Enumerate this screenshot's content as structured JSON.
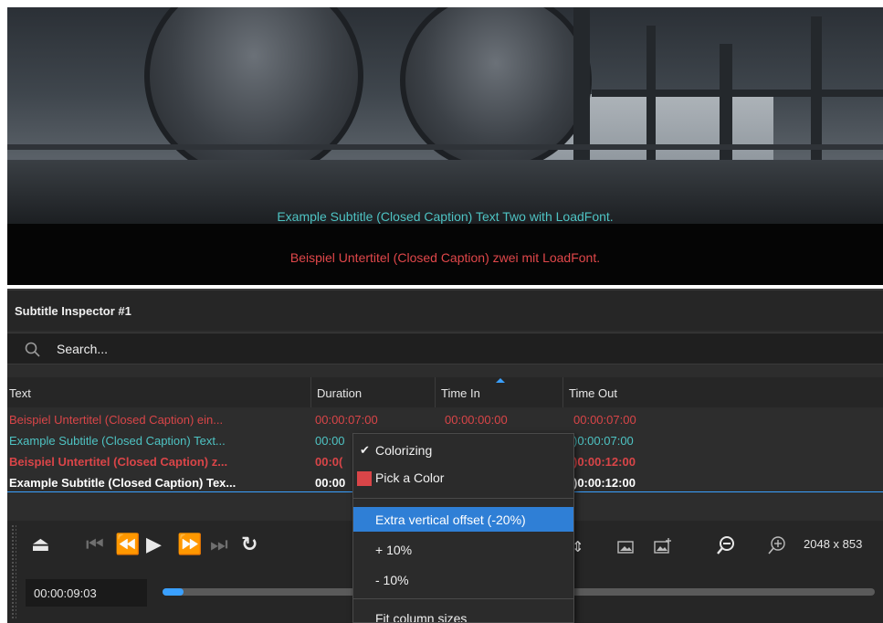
{
  "video": {
    "subtitle_line_1": "Example Subtitle (Closed Caption) Text Two with LoadFont.",
    "subtitle_line_2": "Beispiel Untertitel (Closed Caption) zwei mit LoadFont."
  },
  "inspector": {
    "title": "Subtitle Inspector #1",
    "search_placeholder": "Search...",
    "columns": [
      "Text",
      "Duration",
      "Time In",
      "Time Out"
    ],
    "rows": [
      {
        "text": "Beispiel Untertitel (Closed Caption) ein...",
        "duration": "00:00:07:00",
        "time_in": "00:00:00:00",
        "time_out": "00:00:07:00",
        "style": "red"
      },
      {
        "text": "Example Subtitle (Closed Caption) Text...",
        "duration": "00:00",
        "time_in": "",
        "time_out": ")0:00:07:00",
        "style": "cyan"
      },
      {
        "text": "Beispiel Untertitel (Closed Caption) z...",
        "duration": "00:0(",
        "time_in": "",
        "time_out": ")0:00:12:00",
        "style": "red-bold"
      },
      {
        "text": "Example Subtitle (Closed Caption) Tex...",
        "duration": "00:00",
        "time_in": "",
        "time_out": ")0:00:12:00",
        "style": "white-bold"
      }
    ]
  },
  "transport": {
    "timecode": "00:00:09:03",
    "resolution": "2048 x 853",
    "progress": 0.03
  },
  "context_menu": {
    "items": [
      {
        "label": "Colorizing",
        "checked": true
      },
      {
        "label": "Pick a Color",
        "swatch": "#d94548"
      },
      {
        "label": "Extra vertical offset (-20%)",
        "highlighted": true
      },
      {
        "label": "+ 10%"
      },
      {
        "label": "- 10%"
      },
      {
        "label": "Fit column sizes"
      }
    ]
  },
  "colors": {
    "accent": "#3aa0ff",
    "red_text": "#d94548",
    "cyan_text": "#4ec3c3",
    "panel_bg": "#2d2d2d"
  }
}
